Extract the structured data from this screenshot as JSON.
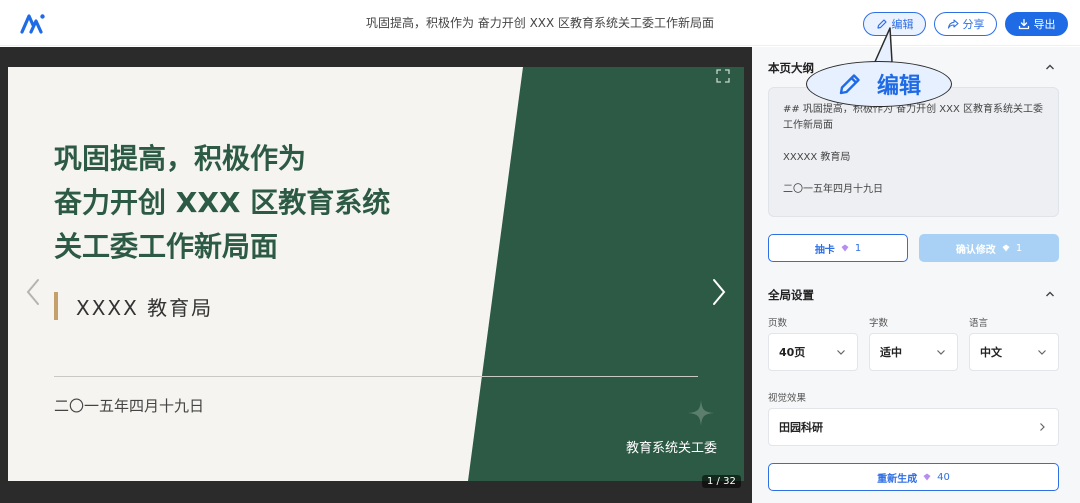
{
  "header": {
    "title": "巩固提高，积极作为 奋力开创 XXX 区教育系统关工委工作新局面",
    "edit_label": "编辑",
    "share_label": "分享",
    "export_label": "导出"
  },
  "slide": {
    "title": "巩固提高，积极作为\n奋力开创 XXX 区教育系统\n关工委工作新局面",
    "org": "XXXX 教育局",
    "date": "二〇一五年四月十九日",
    "footer_org": "教育系统关工委",
    "pager": "1 / 32"
  },
  "panel": {
    "outline_title": "本页大纲",
    "outline_lines": [
      "## 巩固提高，积极作为 奋力开创 XXX 区教育系统关工委工作新局面",
      "XXXXX 教育局",
      "二〇一五年四月十九日"
    ],
    "draw_label": "抽卡",
    "draw_count": "1",
    "confirm_label": "确认修改",
    "confirm_count": "1",
    "global_title": "全局设置",
    "pages_label": "页数",
    "pages_value": "40页",
    "words_label": "字数",
    "words_value": "适中",
    "lang_label": "语言",
    "lang_value": "中文",
    "visual_label": "视觉效果",
    "visual_value": "田园科研",
    "regen_label": "重新生成",
    "regen_count": "40"
  },
  "callout": {
    "label": "编辑"
  },
  "colors": {
    "accent": "#1f6be6",
    "slide_green": "#2d5a44",
    "slide_gold": "#c4a06d"
  }
}
